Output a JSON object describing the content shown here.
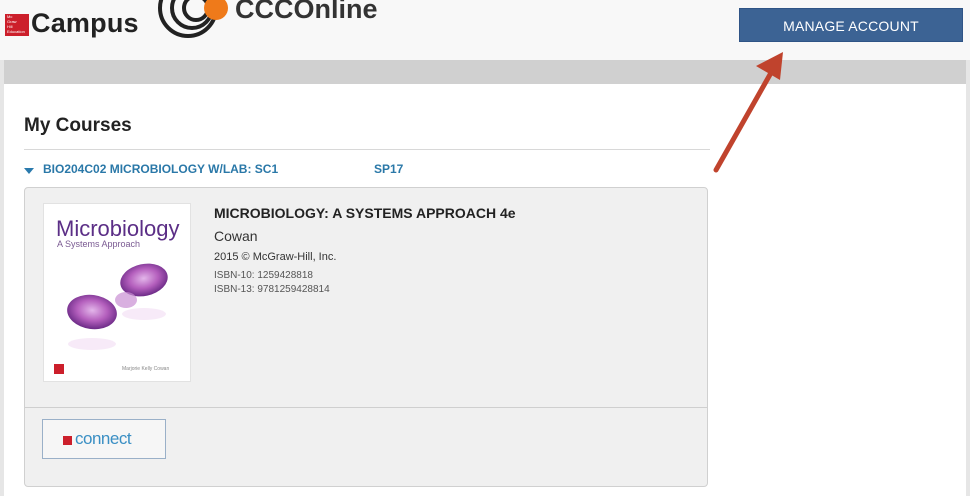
{
  "header": {
    "mh_logo_lines": [
      "Mc",
      "Graw",
      "Hill",
      "Education"
    ],
    "campus_label": "Campus",
    "ccc_label": "CCCOnline",
    "manage_button": "MANAGE ACCOUNT"
  },
  "main": {
    "heading": "My Courses",
    "course": {
      "name": "BIO204C02 MICROBIOLOGY W/LAB: SC1",
      "term": "SP17"
    },
    "book": {
      "cover_title": "Microbiology",
      "cover_subtitle": "A Systems Approach",
      "cover_author": "Marjorie Kelly Cowan",
      "title": "MICROBIOLOGY: A SYSTEMS APPROACH 4e",
      "author": "Cowan",
      "publisher": "2015 © McGraw-Hill, Inc.",
      "isbn10": "ISBN-10: 1259428818",
      "isbn13": "ISBN-13: 9781259428814"
    },
    "connect_label": "connect"
  },
  "colors": {
    "manage_button": "#3c6394",
    "link": "#2a78a8",
    "annotation_arrow": "#c0432d",
    "brand_red": "#cc1f2b",
    "ccc_orange": "#ef7a1a"
  }
}
